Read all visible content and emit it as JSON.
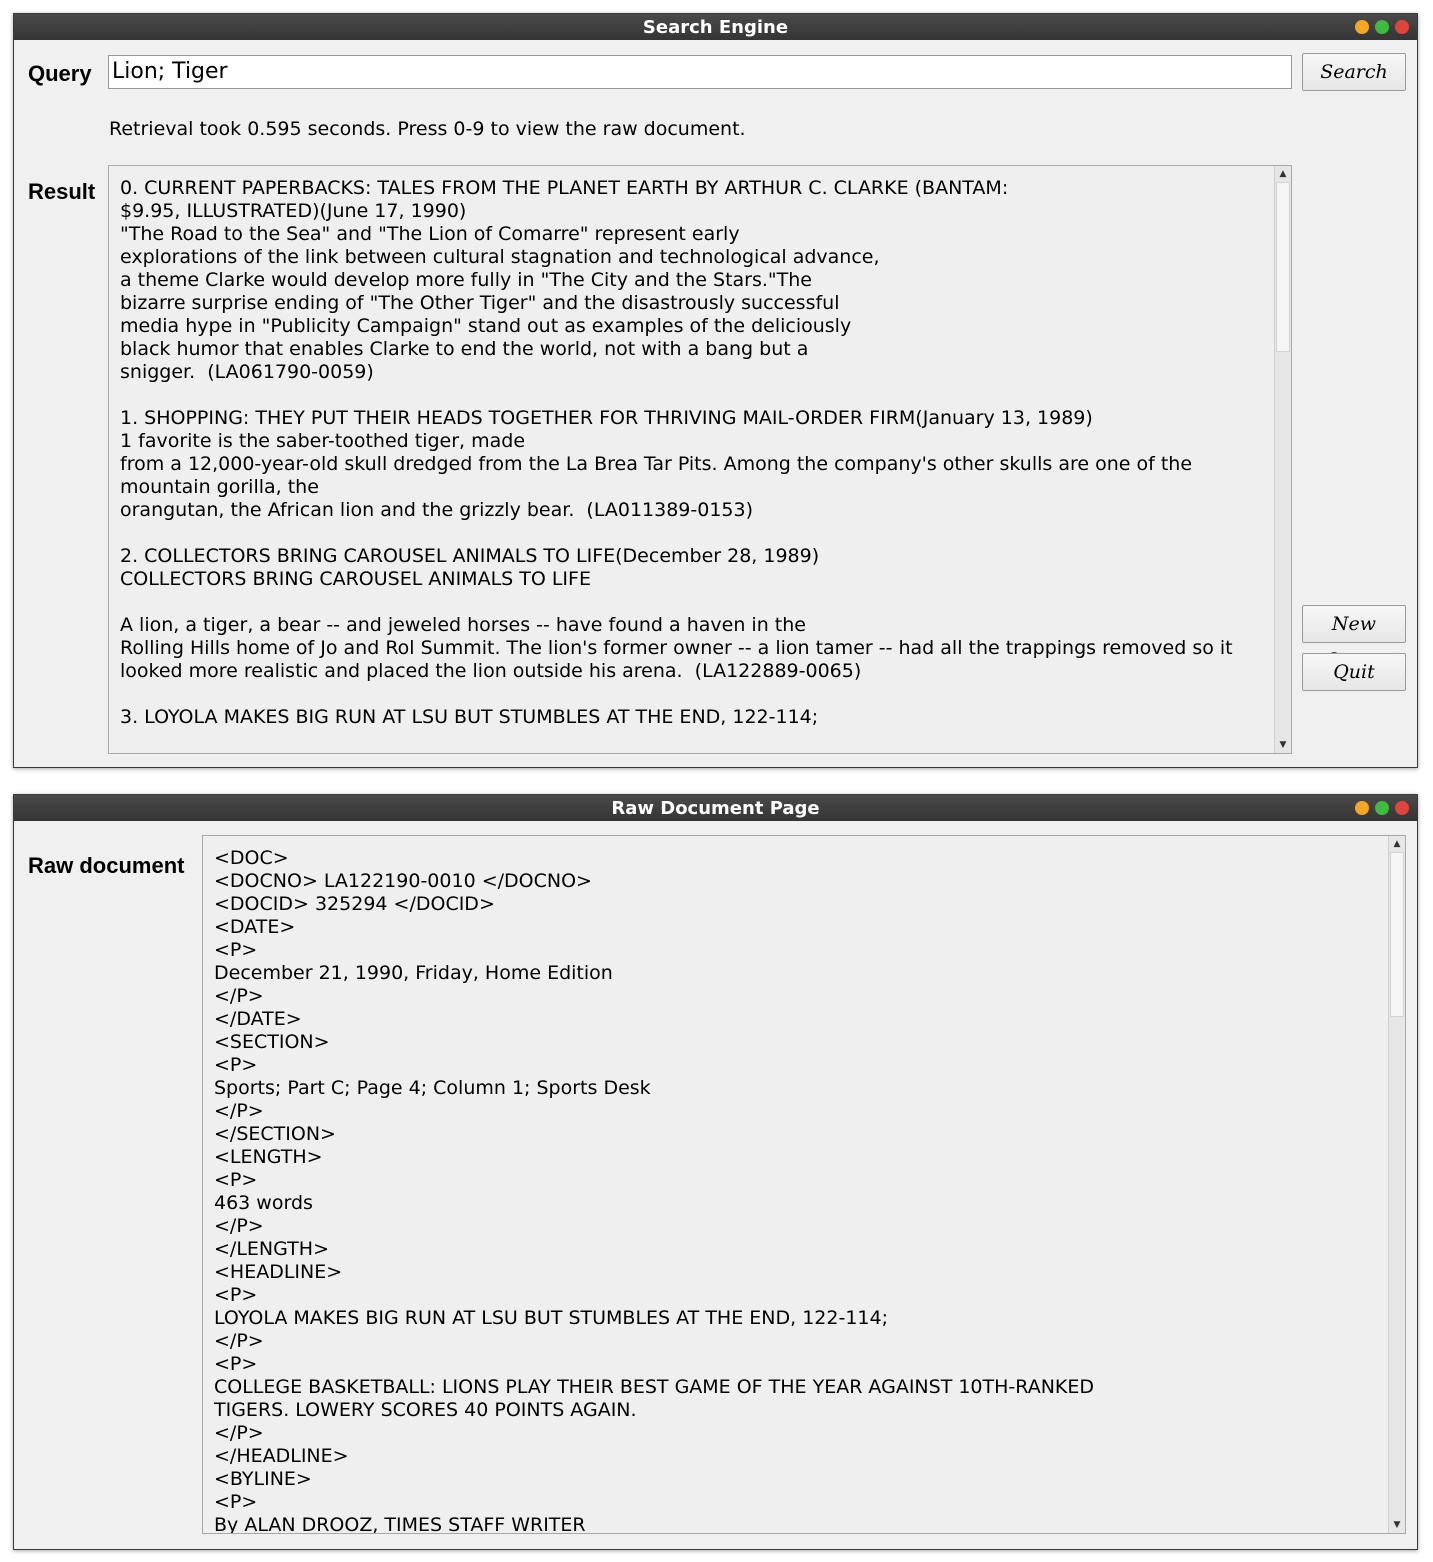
{
  "search_window": {
    "title": "Search Engine",
    "query_label": "Query",
    "query_value": "Lion; Tiger",
    "search_button": "Search",
    "status": "Retrieval took 0.595 seconds. Press 0-9 to view the raw document.",
    "result_label": "Result",
    "result_text": "0. CURRENT PAPERBACKS: TALES FROM THE PLANET EARTH BY ARTHUR C. CLARKE (BANTAM:\n$9.95, ILLUSTRATED)(June 17, 1990)\n\"The Road to the Sea\" and \"The Lion of Comarre\" represent early\nexplorations of the link between cultural stagnation and technological advance,\na theme Clarke would develop more fully in \"The City and the Stars.\"The\nbizarre surprise ending of \"The Other Tiger\" and the disastrously successful\nmedia hype in \"Publicity Campaign\" stand out as examples of the deliciously\nblack humor that enables Clarke to end the world, not with a bang but a\nsnigger.  (LA061790-0059)\n\n1. SHOPPING: THEY PUT THEIR HEADS TOGETHER FOR THRIVING MAIL-ORDER FIRM(January 13, 1989)\n1 favorite is the saber-toothed tiger, made\nfrom a 12,000-year-old skull dredged from the La Brea Tar Pits. Among the company's other skulls are one of the mountain gorilla, the\norangutan, the African lion and the grizzly bear.  (LA011389-0153)\n\n2. COLLECTORS BRING CAROUSEL ANIMALS TO LIFE(December 28, 1989)\nCOLLECTORS BRING CAROUSEL ANIMALS TO LIFE\n\nA lion, a tiger, a bear -- and jeweled horses -- have found a haven in the\nRolling Hills home of Jo and Rol Summit. The lion's former owner -- a lion tamer -- had all the trappings removed so it\nlooked more realistic and placed the lion outside his arena.  (LA122889-0065)\n\n3. LOYOLA MAKES BIG RUN AT LSU BUT STUMBLES AT THE END, 122-114;",
    "new_query_button": "New Query",
    "quit_button": "Quit"
  },
  "raw_window": {
    "title": "Raw Document Page",
    "raw_label": "Raw document",
    "raw_text": "<DOC>\n<DOCNO> LA122190-0010 </DOCNO>\n<DOCID> 325294 </DOCID>\n<DATE>\n<P>\nDecember 21, 1990, Friday, Home Edition\n</P>\n</DATE>\n<SECTION>\n<P>\nSports; Part C; Page 4; Column 1; Sports Desk\n</P>\n</SECTION>\n<LENGTH>\n<P>\n463 words\n</P>\n</LENGTH>\n<HEADLINE>\n<P>\nLOYOLA MAKES BIG RUN AT LSU BUT STUMBLES AT THE END, 122-114;\n</P>\n<P>\nCOLLEGE BASKETBALL: LIONS PLAY THEIR BEST GAME OF THE YEAR AGAINST 10TH-RANKED\nTIGERS. LOWERY SCORES 40 POINTS AGAIN.\n</P>\n</HEADLINE>\n<BYLINE>\n<P>\nBy ALAN DROOZ, TIMES STAFF WRITER"
  },
  "colors": {
    "window_bg": "#f0f0f0",
    "titlebar": "#3a3a3a",
    "minimize": "#f5a623",
    "maximize": "#3fbb3f",
    "close": "#e0443a"
  }
}
